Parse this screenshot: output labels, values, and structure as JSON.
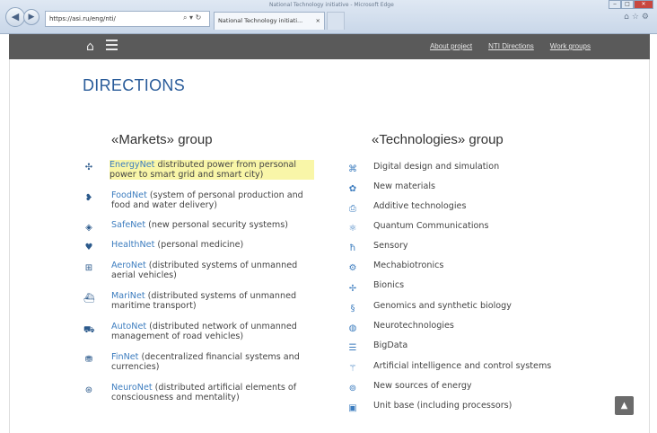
{
  "browser": {
    "address": "https://asi.ru/eng/nti/",
    "tab_title": "National Technology initiati...",
    "window_title": "National Technology initiative - Microsoft Edge",
    "tab_close": "×"
  },
  "header": {
    "nav": [
      "About project",
      "NTI Directions",
      "Work groups"
    ]
  },
  "page": {
    "title": "DIRECTIONS"
  },
  "markets": {
    "title": "«Markets» group",
    "items": [
      {
        "link": "EnergyNet",
        "desc": " distributed power from personal power to smart grid and smart city)",
        "highlight": true,
        "icon": "wind-turbine-icon"
      },
      {
        "link": "FoodNet",
        "desc": " (system of personal production and food and water delivery)",
        "icon": "drop-icon"
      },
      {
        "link": "SafeNet",
        "desc": " (new personal security systems)",
        "icon": "shield-icon"
      },
      {
        "link": "HealthNet",
        "desc": " (personal medicine)",
        "icon": "heart-icon"
      },
      {
        "link": "AeroNet",
        "desc": " (distributed systems of unmanned aerial vehicles)",
        "icon": "drone-icon"
      },
      {
        "link": "MariNet",
        "desc": " (distributed systems of unmanned maritime transport)",
        "icon": "ship-icon"
      },
      {
        "link": "AutoNet",
        "desc": " (distributed network of unmanned management of road vehicles)",
        "icon": "car-icon"
      },
      {
        "link": "FinNet",
        "desc": " (decentralized financial systems and currencies)",
        "icon": "coins-icon"
      },
      {
        "link": "NeuroNet",
        "desc": " (distributed artificial elements of consciousness and mentality)",
        "icon": "brain-icon"
      }
    ]
  },
  "technologies": {
    "title": "«Technologies» group",
    "items": [
      {
        "label": "Digital design and simulation",
        "icon": "design-icon"
      },
      {
        "label": "New materials",
        "icon": "molecule-icon"
      },
      {
        "label": "Additive technologies",
        "icon": "printer-icon"
      },
      {
        "label": "Quantum Communications",
        "icon": "quantum-icon"
      },
      {
        "label": "Sensory",
        "icon": "hand-icon"
      },
      {
        "label": "Mechabiotronics",
        "icon": "robot-icon"
      },
      {
        "label": "Bionics",
        "icon": "bionics-icon"
      },
      {
        "label": "Genomics and synthetic biology",
        "icon": "dna-icon"
      },
      {
        "label": "Neurotechnologies",
        "icon": "neuro-icon"
      },
      {
        "label": "BigData",
        "icon": "database-icon"
      },
      {
        "label": "Artificial intelligence and control systems",
        "icon": "ai-icon"
      },
      {
        "label": "New sources of energy",
        "icon": "energy-icon"
      },
      {
        "label": "Unit base (including processors)",
        "icon": "chip-icon"
      }
    ]
  }
}
